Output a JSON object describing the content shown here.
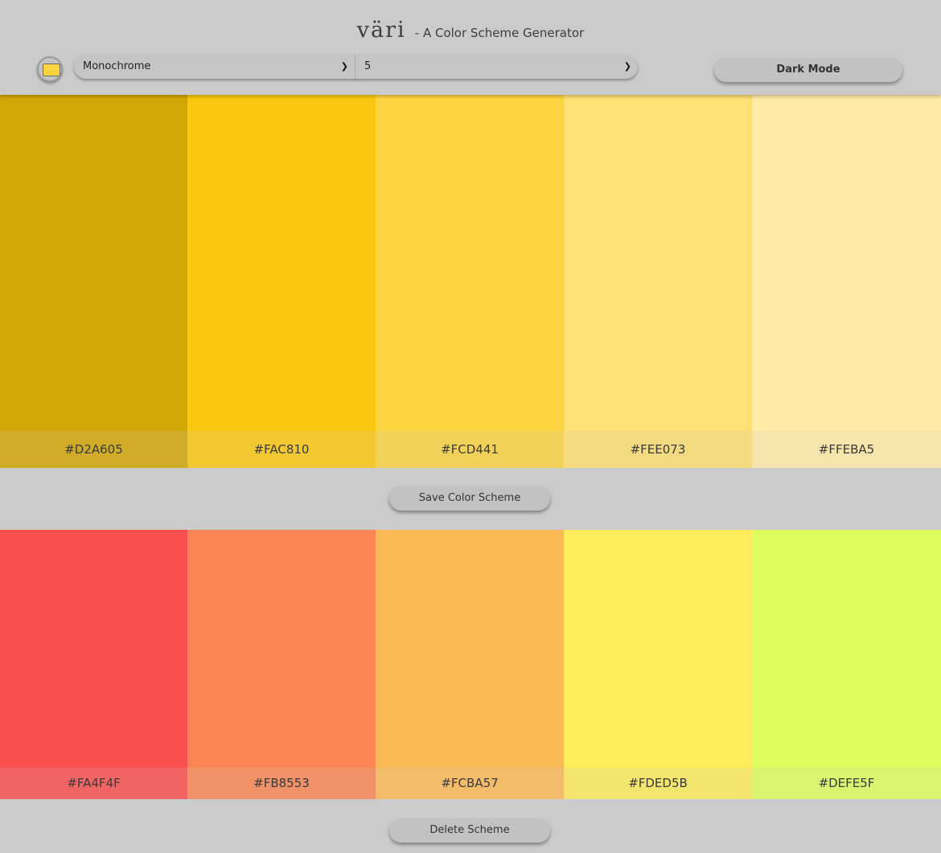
{
  "app": {
    "logo": "väri",
    "tagline": "- A Color Scheme Generator"
  },
  "controls": {
    "seed_color": "#FCD441",
    "mode_value": "Monochrome",
    "count_value": "5",
    "dark_mode_label": "Dark Mode"
  },
  "current_scheme": {
    "colors": [
      {
        "hex": "#D2A605",
        "label": "#D2A605"
      },
      {
        "hex": "#FAC810",
        "label": "#FAC810"
      },
      {
        "hex": "#FCD441",
        "label": "#FCD441"
      },
      {
        "hex": "#FEE073",
        "label": "#FEE073"
      },
      {
        "hex": "#FFEBA5",
        "label": "#FFEBA5"
      }
    ],
    "save_label": "Save Color Scheme"
  },
  "saved_scheme": {
    "colors": [
      {
        "hex": "#FA4F4F",
        "label": "#FA4F4F"
      },
      {
        "hex": "#FB8553",
        "label": "#FB8553"
      },
      {
        "hex": "#FCBA57",
        "label": "#FCBA57"
      },
      {
        "hex": "#FDED5B",
        "label": "#FDED5B"
      },
      {
        "hex": "#DEFE5F",
        "label": "#DEFE5F"
      }
    ],
    "delete_label": "Delete Scheme"
  }
}
